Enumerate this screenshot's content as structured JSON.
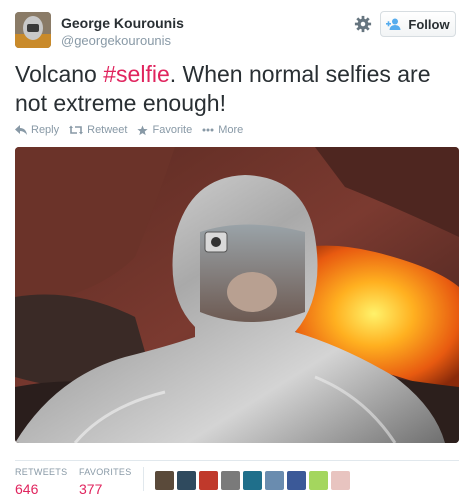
{
  "author": {
    "name": "George Kourounis",
    "handle": "@georgekourounis"
  },
  "follow_label": "Follow",
  "tweet": {
    "text_before": "Volcano ",
    "hashtag": "#selfie",
    "text_after": ". When normal selfies are not extreme enough!"
  },
  "actions": {
    "reply": "Reply",
    "retweet": "Retweet",
    "favorite": "Favorite",
    "more": "More"
  },
  "stats": {
    "retweets_label": "RETWEETS",
    "retweets_count": "646",
    "favorites_label": "FAVORITES",
    "favorites_count": "377"
  },
  "colors": {
    "accent": "#e0245e",
    "muted": "#8899a6",
    "text": "#292f33",
    "follow_icon": "#55acee"
  },
  "icons": [
    "gear-icon",
    "add-user-icon",
    "reply-icon",
    "retweet-icon",
    "star-icon",
    "more-icon"
  ]
}
